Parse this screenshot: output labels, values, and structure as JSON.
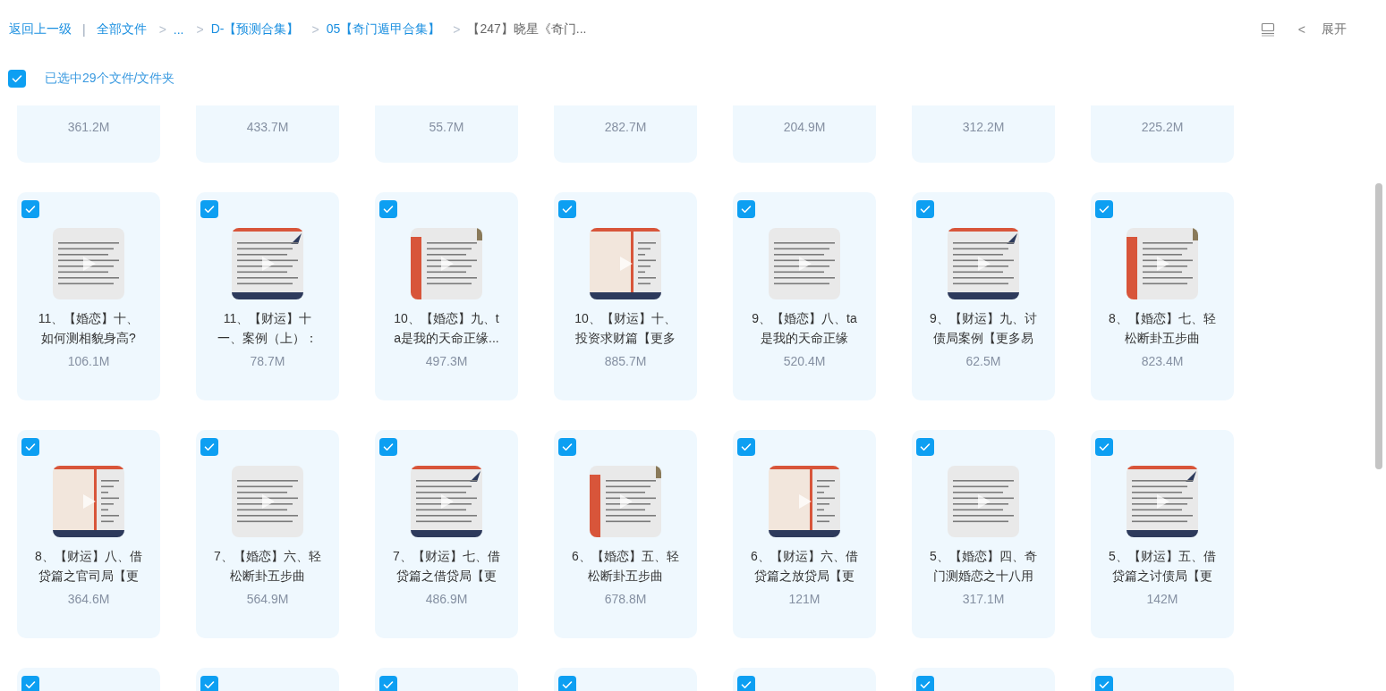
{
  "breadcrumb": {
    "back": "返回上一级",
    "separator": "|",
    "items": [
      {
        "label": "全部文件",
        "current": false
      },
      {
        "label": "...",
        "current": false
      },
      {
        "label": "D-【预测合集】",
        "current": false
      },
      {
        "label": "05【奇门遁甲合集】",
        "current": false
      },
      {
        "label": "【247】晓星《奇门...",
        "current": true
      }
    ],
    "chevron": ">"
  },
  "toolbar": {
    "collapse_glyph": "<",
    "expand_label": "展开"
  },
  "selection": {
    "checked": true,
    "label": "已选中29个文件/文件夹"
  },
  "files": [
    {
      "size": "361.2M"
    },
    {
      "size": "433.7M"
    },
    {
      "size": "55.7M"
    },
    {
      "size": "282.7M"
    },
    {
      "size": "204.9M"
    },
    {
      "size": "312.2M"
    },
    {
      "size": "225.2M"
    },
    {
      "selected": true,
      "title_lines": [
        "11、【婚恋】十、",
        "如何测相貌身高?"
      ],
      "size": "106.1M"
    },
    {
      "selected": true,
      "title_lines": [
        "11、【财运】十",
        "一、案例（上）："
      ],
      "size": "78.7M"
    },
    {
      "selected": true,
      "title_lines": [
        "10、【婚恋】九、t",
        "a是我的天命正缘..."
      ],
      "size": "497.3M"
    },
    {
      "selected": true,
      "title_lines": [
        "10、【财运】十、",
        "投资求财篇【更多"
      ],
      "size": "885.7M"
    },
    {
      "selected": true,
      "title_lines": [
        "9、【婚恋】八、ta",
        "是我的天命正缘"
      ],
      "size": "520.4M"
    },
    {
      "selected": true,
      "title_lines": [
        "9、【财运】九、讨",
        "债局案例【更多易"
      ],
      "size": "62.5M"
    },
    {
      "selected": true,
      "title_lines": [
        "8、【婚恋】七、轻",
        "松断卦五步曲"
      ],
      "size": "823.4M"
    },
    {
      "selected": true,
      "title_lines": [
        "8、【财运】八、借",
        "贷篇之官司局【更"
      ],
      "size": "364.6M"
    },
    {
      "selected": true,
      "title_lines": [
        "7、【婚恋】六、轻",
        "松断卦五步曲"
      ],
      "size": "564.9M"
    },
    {
      "selected": true,
      "title_lines": [
        "7、【财运】七、借",
        "贷篇之借贷局【更"
      ],
      "size": "486.9M"
    },
    {
      "selected": true,
      "title_lines": [
        "6、【婚恋】五、轻",
        "松断卦五步曲"
      ],
      "size": "678.8M"
    },
    {
      "selected": true,
      "title_lines": [
        "6、【财运】六、借",
        "贷篇之放贷局【更"
      ],
      "size": "121M"
    },
    {
      "selected": true,
      "title_lines": [
        "5、【婚恋】四、奇",
        "门测婚恋之十八用"
      ],
      "size": "317.1M"
    },
    {
      "selected": true,
      "title_lines": [
        "5、【财运】五、借",
        "贷篇之讨债局【更"
      ],
      "size": "142M"
    },
    {
      "selected": true
    },
    {
      "selected": true
    },
    {
      "selected": true
    },
    {
      "selected": true
    },
    {
      "selected": true
    },
    {
      "selected": true
    },
    {
      "selected": true
    }
  ]
}
